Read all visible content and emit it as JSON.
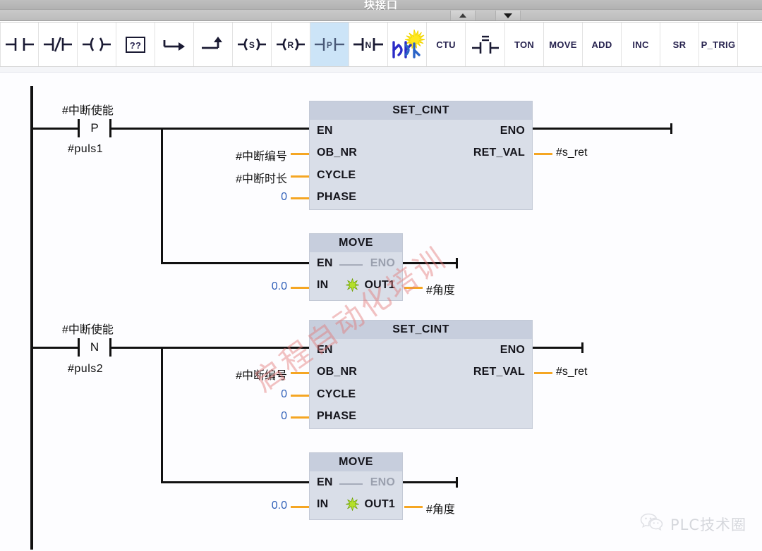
{
  "window": {
    "title": "块接口",
    "nav": {
      "up_label": "▲",
      "down_label": "▼"
    }
  },
  "toolbar": {
    "buttons": [
      {
        "name": "normally-open-contact",
        "label": "",
        "icon": "contact-no-icon",
        "selected": false
      },
      {
        "name": "normally-closed-contact",
        "label": "",
        "icon": "contact-nc-icon",
        "selected": false
      },
      {
        "name": "output-coil",
        "label": "",
        "icon": "coil-icon",
        "selected": false
      },
      {
        "name": "empty-box",
        "label": "??",
        "icon": "empty-box-icon",
        "selected": false
      },
      {
        "name": "open-branch",
        "label": "",
        "icon": "open-branch-icon",
        "selected": false
      },
      {
        "name": "close-branch",
        "label": "",
        "icon": "close-branch-icon",
        "selected": false
      },
      {
        "name": "set-coil",
        "label": "S",
        "icon": "set-coil-icon",
        "selected": false
      },
      {
        "name": "reset-coil",
        "label": "R",
        "icon": "reset-coil-icon",
        "selected": false
      },
      {
        "name": "positive-edge-contact",
        "label": "P",
        "icon": "p-contact-icon",
        "selected": true
      },
      {
        "name": "negative-edge-contact",
        "label": "N",
        "icon": "n-contact-icon",
        "selected": false
      },
      {
        "name": "open-favorites",
        "label": "",
        "icon": "favorites-star-icon",
        "selected": false
      },
      {
        "name": "ctu-counter",
        "label": "CTU",
        "icon": "text-icon",
        "selected": false
      },
      {
        "name": "compare-equal",
        "label": "",
        "icon": "compare-equal-icon",
        "selected": false
      },
      {
        "name": "ton-timer",
        "label": "TON",
        "icon": "text-icon",
        "selected": false
      },
      {
        "name": "move-instruction",
        "label": "MOVE",
        "icon": "text-icon",
        "selected": false
      },
      {
        "name": "add-instruction",
        "label": "ADD",
        "icon": "text-icon",
        "selected": false
      },
      {
        "name": "inc-instruction",
        "label": "INC",
        "icon": "text-icon",
        "selected": false
      },
      {
        "name": "sr-flipflop",
        "label": "SR",
        "icon": "text-icon",
        "selected": false
      },
      {
        "name": "p-trig-instruction",
        "label": "P_TRIG",
        "icon": "text-icon",
        "selected": false
      }
    ]
  },
  "ladder": {
    "networks": [
      {
        "id": "network-1",
        "contact": {
          "label_above": "#中断使能",
          "label_below": "#puls1",
          "type_letter": "P"
        },
        "blocks": [
          {
            "name": "set-cint-block-1",
            "title": "SET_CINT",
            "inputs": [
              {
                "pin": "EN",
                "operand": ""
              },
              {
                "pin": "OB_NR",
                "operand": "#中断编号",
                "numeric": false
              },
              {
                "pin": "CYCLE",
                "operand": "#中断时长",
                "numeric": false
              },
              {
                "pin": "PHASE",
                "operand": "0",
                "numeric": true
              }
            ],
            "outputs": [
              {
                "pin": "ENO",
                "operand": ""
              },
              {
                "pin": "RET_VAL",
                "operand": "#s_ret"
              }
            ]
          },
          {
            "name": "move-block-1",
            "title": "MOVE",
            "inputs": [
              {
                "pin": "EN",
                "operand": ""
              },
              {
                "pin": "IN",
                "operand": "0.0",
                "numeric": true
              }
            ],
            "outputs": [
              {
                "pin": "ENO",
                "operand": "",
                "dim": true
              },
              {
                "pin": "OUT1",
                "operand": "#角度"
              }
            ]
          }
        ]
      },
      {
        "id": "network-2",
        "contact": {
          "label_above": "#中断使能",
          "label_below": "#puls2",
          "type_letter": "N"
        },
        "blocks": [
          {
            "name": "set-cint-block-2",
            "title": "SET_CINT",
            "inputs": [
              {
                "pin": "EN",
                "operand": ""
              },
              {
                "pin": "OB_NR",
                "operand": "#中断编号",
                "numeric": false
              },
              {
                "pin": "CYCLE",
                "operand": "0",
                "numeric": true
              },
              {
                "pin": "PHASE",
                "operand": "0",
                "numeric": true
              }
            ],
            "outputs": [
              {
                "pin": "ENO",
                "operand": ""
              },
              {
                "pin": "RET_VAL",
                "operand": "#s_ret"
              }
            ]
          },
          {
            "name": "move-block-2",
            "title": "MOVE",
            "inputs": [
              {
                "pin": "EN",
                "operand": ""
              },
              {
                "pin": "IN",
                "operand": "0.0",
                "numeric": true
              }
            ],
            "outputs": [
              {
                "pin": "ENO",
                "operand": "",
                "dim": true
              },
              {
                "pin": "OUT1",
                "operand": "#角度"
              }
            ]
          }
        ]
      }
    ]
  },
  "watermarks": {
    "diagonal": "启程自动化培训",
    "corner": "PLC技术圈"
  },
  "colors": {
    "selection": "#cce4f7",
    "block_body": "#d9dee8",
    "block_header": "#c7cedd",
    "wire": "#111111",
    "pin_wire": "#f5a623",
    "numeric_operand": "#2f5fb8",
    "toolbar_text": "#27234f"
  }
}
